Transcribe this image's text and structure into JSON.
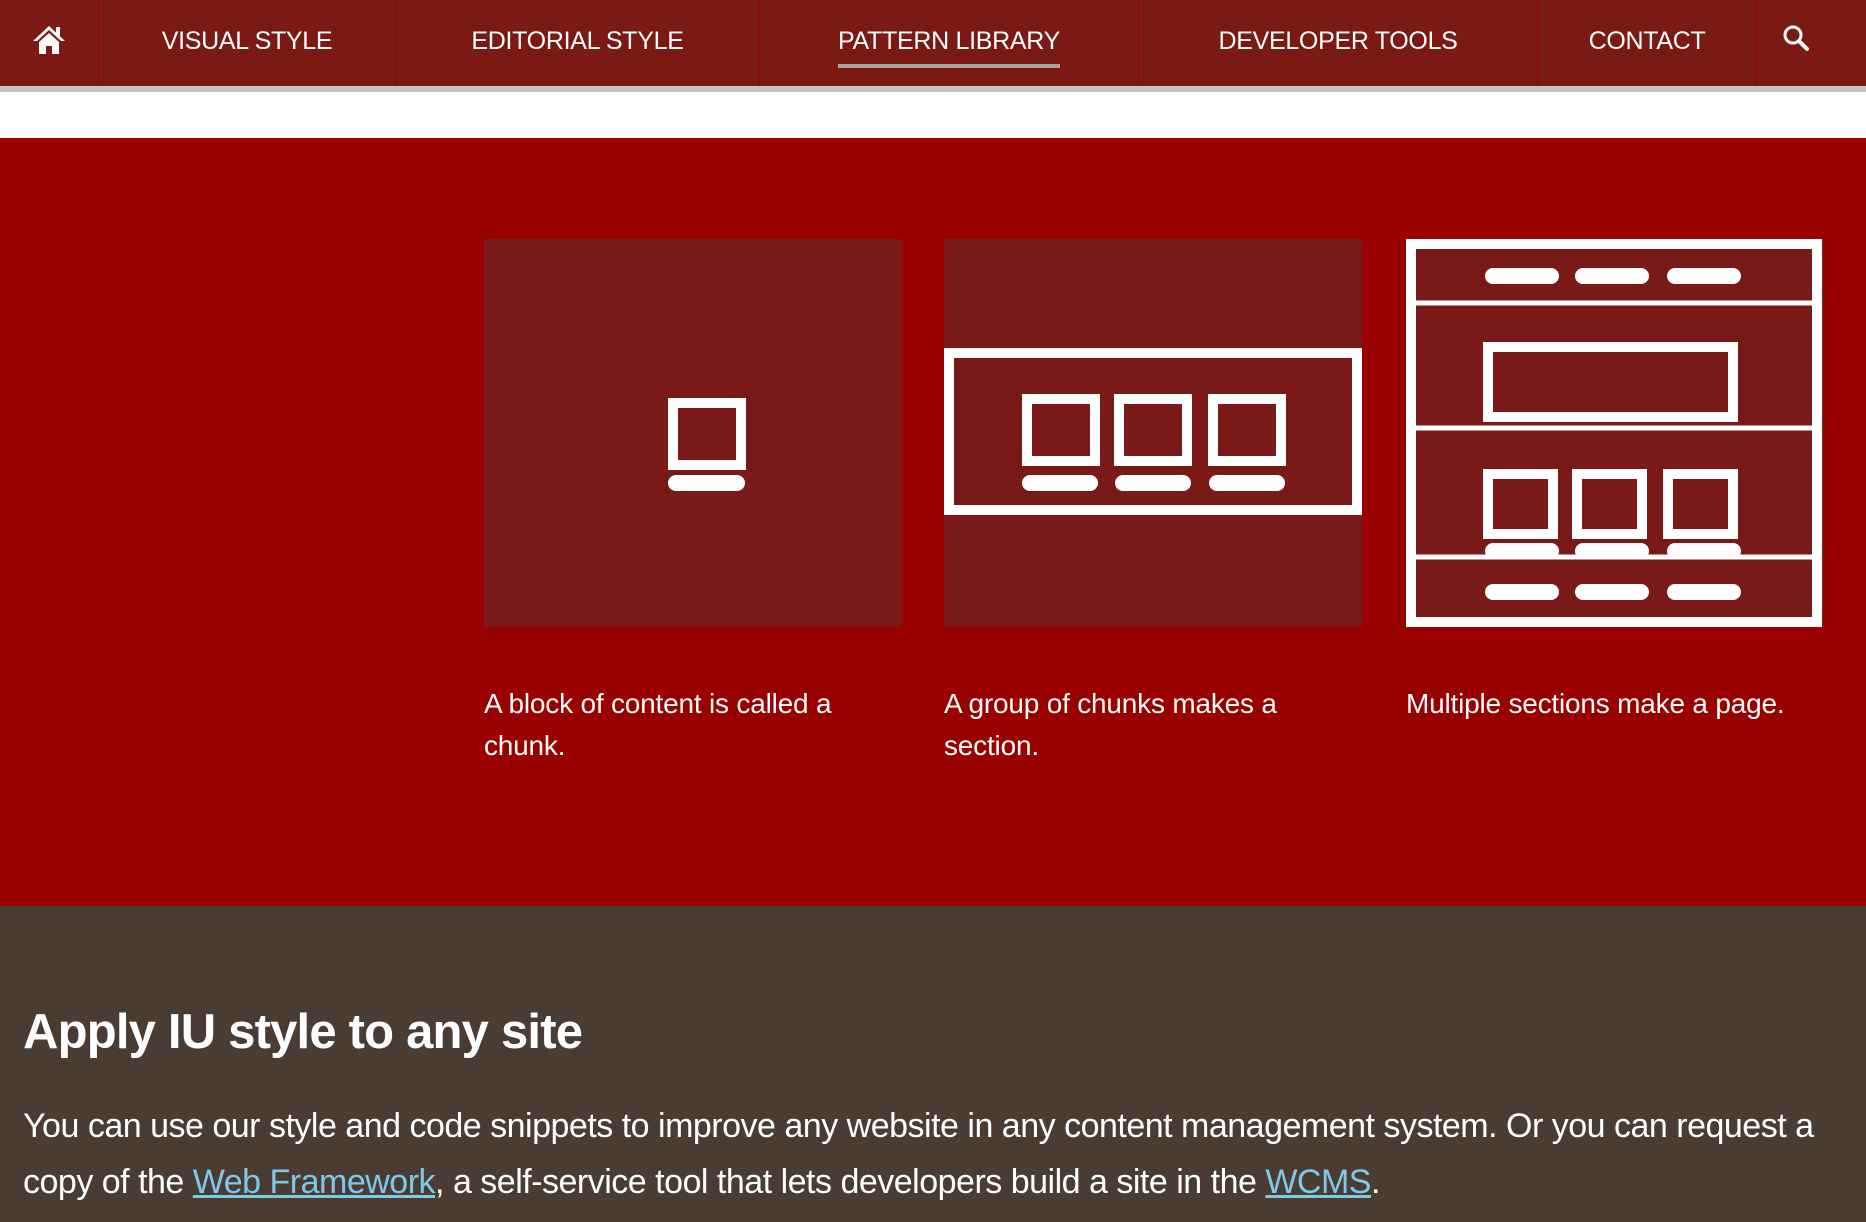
{
  "nav": {
    "items": [
      {
        "label": "VISUAL STYLE"
      },
      {
        "label": "EDITORIAL STYLE"
      },
      {
        "label": "PATTERN LIBRARY",
        "active": true
      },
      {
        "label": "DEVELOPER TOOLS"
      },
      {
        "label": "CONTACT"
      }
    ],
    "home_icon": "home-icon",
    "search_icon": "search-icon"
  },
  "hero": {
    "tiles": [
      {
        "icon": "chunk-diagram-icon",
        "caption": "A block of content is called a chunk."
      },
      {
        "icon": "section-diagram-icon",
        "caption": "A group of chunks makes a section."
      },
      {
        "icon": "page-diagram-icon",
        "caption": "Multiple sections make a page."
      }
    ]
  },
  "apply": {
    "heading": "Apply IU style to any site",
    "text_1": "You can use our style and code snippets to improve any website in any content management system. Or you can request a copy of the ",
    "link_1": "Web Framework",
    "text_2": ", a self-service tool that lets developers build a site in the ",
    "link_2": "WCMS",
    "text_3": "."
  },
  "colors": {
    "nav_bg": "#7a1a13",
    "hero_bg": "#990000",
    "tile_bg": "#7a1a18",
    "footer_bg": "#4a3c33",
    "link": "#7fc8ea"
  }
}
